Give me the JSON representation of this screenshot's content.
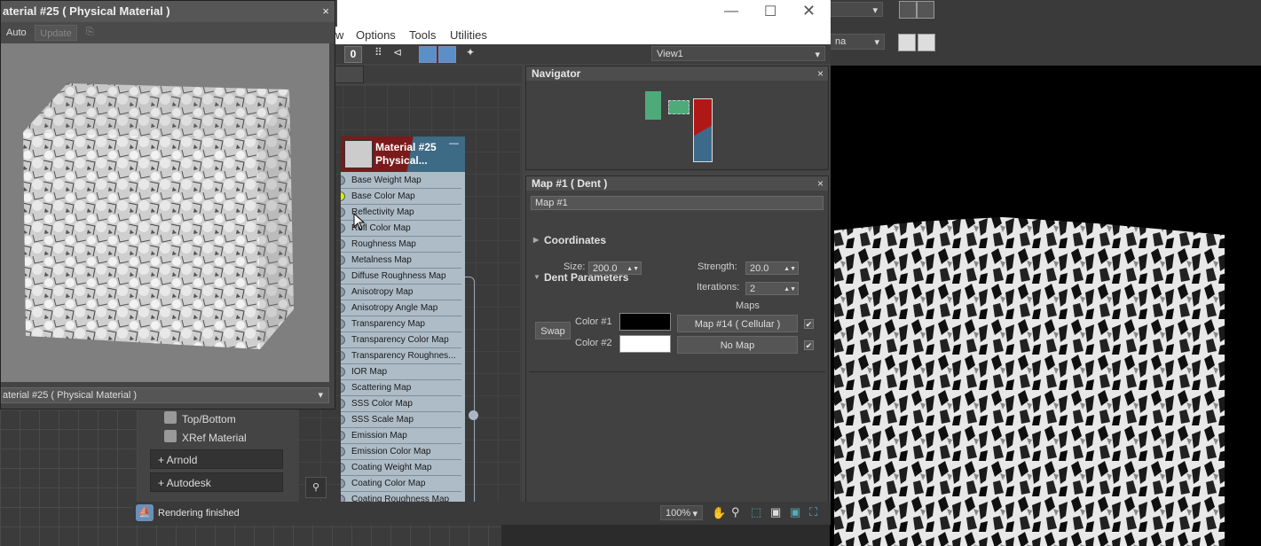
{
  "material_editor": {
    "title": "aterial #25  ( Physical Material )",
    "auto_label": "Auto",
    "update_label": "Update",
    "material_dropdown": "aterial #25  ( Physical Material )"
  },
  "slate": {
    "menu": [
      "w",
      "Options",
      "Tools",
      "Utilities"
    ],
    "view_dropdown": "View1",
    "toolbar_value": "0"
  },
  "material_list": {
    "items": [
      "Top/Bottom",
      "XRef Material"
    ],
    "groups": [
      "+ Arnold",
      "+ Autodesk"
    ]
  },
  "node": {
    "title_line1": "Material #25",
    "title_line2": "Physical...",
    "slots": [
      "Base Weight Map",
      "Base Color Map",
      "Reflectivity Map",
      "Refl Color Map",
      "Roughness Map",
      "Metalness Map",
      "Diffuse Roughness Map",
      "Anisotropy Map",
      "Anisotropy Angle Map",
      "Transparency Map",
      "Transparency Color Map",
      "Transparency Roughnes...",
      "IOR Map",
      "Scattering Map",
      "SSS Color Map",
      "SSS Scale Map",
      "Emission Map",
      "Emission Color Map",
      "Coating Weight Map",
      "Coating Color Map",
      "Coating Roughness Map"
    ]
  },
  "navigator": {
    "title": "Navigator"
  },
  "params": {
    "title": "Map #1  ( Dent )",
    "name_field": "Map #1",
    "rollouts": {
      "coordinates": "Coordinates",
      "dent": "Dent Parameters"
    },
    "size_label": "Size:",
    "size_value": "200.0",
    "strength_label": "Strength:",
    "strength_value": "20.0",
    "iterations_label": "Iterations:",
    "iterations_value": "2",
    "maps_label": "Maps",
    "swap_label": "Swap",
    "color1_label": "Color #1",
    "color2_label": "Color #2",
    "color1_map": "Map #14  ( Cellular )",
    "color2_map": "No Map"
  },
  "status": {
    "text": "Rendering finished",
    "zoom": "100%"
  },
  "colors": {
    "color1": "#000000",
    "color2": "#ffffff",
    "active_socket": "#d4f000"
  }
}
